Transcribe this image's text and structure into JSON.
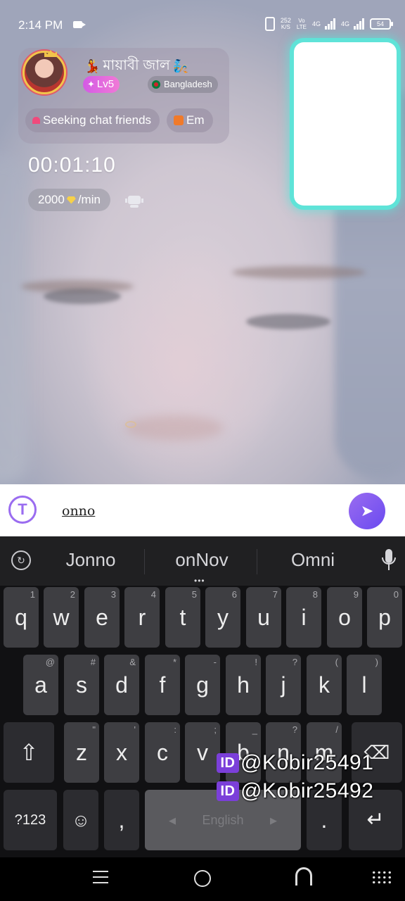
{
  "status_bar": {
    "time": "2:14 PM",
    "net_speed_value": "252",
    "net_speed_unit": "K/S",
    "network_top": "Vo",
    "network_bottom": "LTE",
    "sim1_label": "4G",
    "sim2_label": "4G",
    "battery": "54"
  },
  "profile": {
    "username": "মায়াবী জাল",
    "level": "Lv5",
    "country": "Bangladesh",
    "tags": [
      "Seeking chat friends",
      "Em"
    ]
  },
  "call": {
    "timer": "00:01:10",
    "rate_amount": "2000",
    "rate_unit": "/min"
  },
  "message": {
    "input_value": "onno"
  },
  "keyboard": {
    "suggestions": [
      "Jonno",
      "onNov",
      "Omni"
    ],
    "row1": [
      {
        "ch": "q",
        "hint": "1"
      },
      {
        "ch": "w",
        "hint": "2"
      },
      {
        "ch": "e",
        "hint": "3"
      },
      {
        "ch": "r",
        "hint": "4"
      },
      {
        "ch": "t",
        "hint": "5"
      },
      {
        "ch": "y",
        "hint": "6"
      },
      {
        "ch": "u",
        "hint": "7"
      },
      {
        "ch": "i",
        "hint": "8"
      },
      {
        "ch": "o",
        "hint": "9"
      },
      {
        "ch": "p",
        "hint": "0"
      }
    ],
    "row2": [
      {
        "ch": "a",
        "hint": "@"
      },
      {
        "ch": "s",
        "hint": "#"
      },
      {
        "ch": "d",
        "hint": "&"
      },
      {
        "ch": "f",
        "hint": "*"
      },
      {
        "ch": "g",
        "hint": "-"
      },
      {
        "ch": "h",
        "hint": "!"
      },
      {
        "ch": "j",
        "hint": "?"
      },
      {
        "ch": "k",
        "hint": "("
      },
      {
        "ch": "l",
        "hint": ")"
      }
    ],
    "row3": [
      {
        "ch": "z",
        "hint": "\""
      },
      {
        "ch": "x",
        "hint": "'"
      },
      {
        "ch": "c",
        "hint": ":"
      },
      {
        "ch": "v",
        "hint": ";"
      },
      {
        "ch": "b",
        "hint": "_"
      },
      {
        "ch": "n",
        "hint": "?"
      },
      {
        "ch": "m",
        "hint": "/"
      }
    ],
    "symbols_key": "?123",
    "comma_key": ",",
    "space_label": "English",
    "period_key": "."
  },
  "watermark": {
    "badge": "ID",
    "lines": [
      "@Kobir25491",
      "@Kobir25492"
    ]
  },
  "colors": {
    "accent": "#9a6cf0",
    "level_badge": "#d45ae5",
    "self_preview_glow": "#5fe3d8"
  },
  "icons": [
    "camera-recording-icon",
    "vibrate-icon",
    "translate-icon",
    "send-icon",
    "clipboard-icon",
    "mic-icon",
    "shift-icon",
    "backspace-icon",
    "emoji-icon",
    "enter-icon",
    "robot-icon",
    "diamond-icon"
  ]
}
